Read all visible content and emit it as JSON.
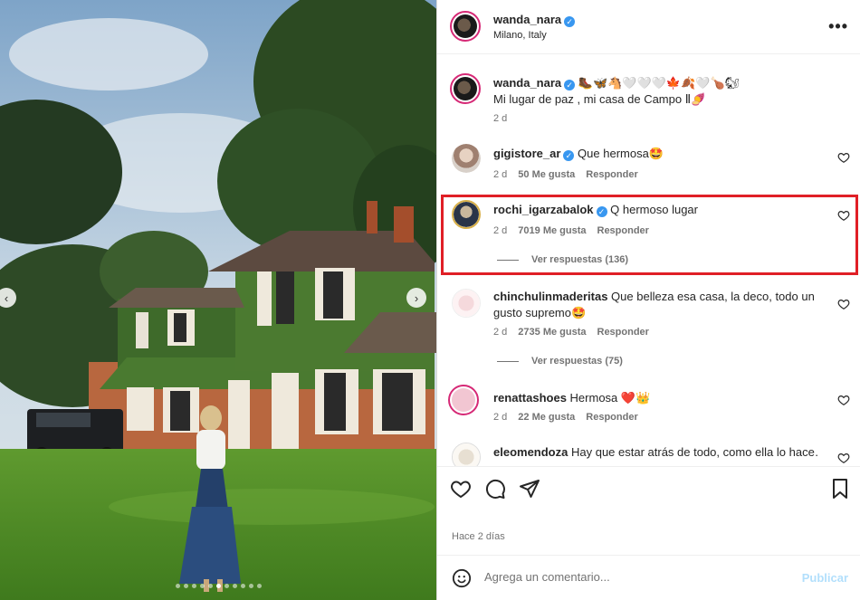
{
  "post": {
    "author": "wanda_nara",
    "location": "Milano, Italy",
    "more_glyph": "•••",
    "caption_author": "wanda_nara",
    "caption_emojis": "🥾🦋🐴🤍🤍🤍🍁🍂🤍🍗🐿",
    "caption_text": "Mi lugar de paz , mi casa de Campo Ⅱ🍠",
    "caption_time": "2 d",
    "verified_glyph": "✓"
  },
  "comments": [
    {
      "user": "gigistore_ar",
      "verified": true,
      "text": "Que hermosa🤩",
      "time": "2 d",
      "likes": "50 Me gusta",
      "reply": "Responder"
    },
    {
      "user": "rochi_igarzabalok",
      "verified": true,
      "text": "Q hermoso lugar",
      "time": "2 d",
      "likes": "7019 Me gusta",
      "reply": "Responder",
      "view_replies": "Ver respuestas (136)"
    },
    {
      "user": "chinchulinmaderitas",
      "verified": false,
      "text": "Que belleza esa casa, la deco, todo un gusto supremo🤩",
      "time": "2 d",
      "likes": "2735 Me gusta",
      "reply": "Responder",
      "view_replies": "Ver respuestas (75)"
    },
    {
      "user": "renattashoes",
      "verified": false,
      "text": "Hermosa ❤️👑",
      "time": "2 d",
      "likes": "22 Me gusta",
      "reply": "Responder"
    },
    {
      "user": "eleomendoza",
      "verified": false,
      "text": "Hay que estar atrás de todo, como ella lo hace…"
    }
  ],
  "timestamp": "Hace 2 días",
  "add_comment": {
    "placeholder": "Agrega un comentario...",
    "publish": "Publicar"
  },
  "carousel": {
    "prev_glyph": "‹",
    "next_glyph": "›",
    "dot_count": 11,
    "active_dot": 5
  },
  "colors": {
    "highlight": "#e01f26",
    "verified": "#3897f0",
    "publish": "#b2dffc",
    "story_ring": "#d62976"
  }
}
